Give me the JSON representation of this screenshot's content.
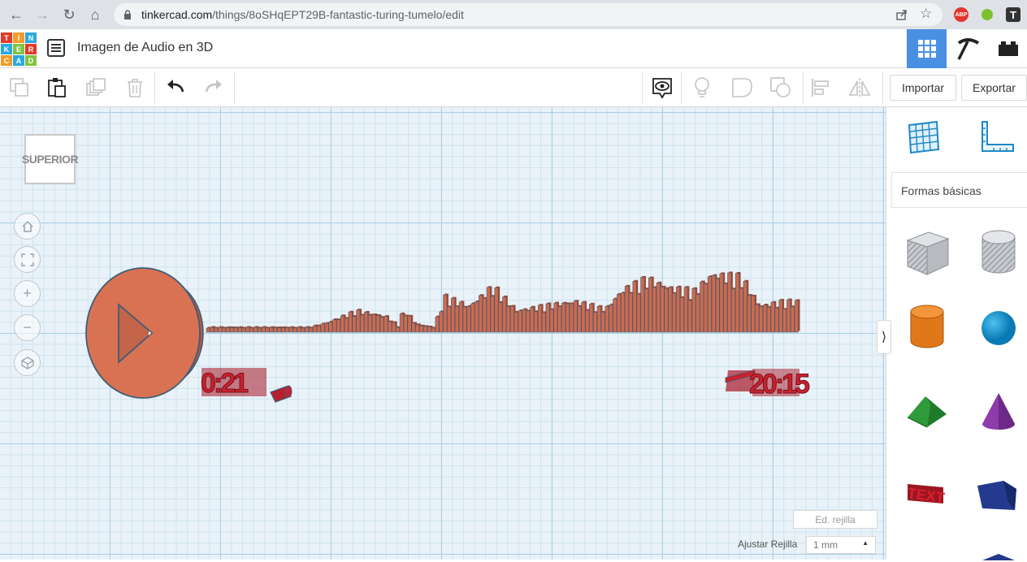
{
  "browser": {
    "url_domain": "tinkercad.com",
    "url_path": "/things/8oSHqEPT29B-fantastic-turing-tumelo/edit",
    "extensions": [
      "ABP",
      "T"
    ]
  },
  "app": {
    "logo_letters": [
      "T",
      "I",
      "N",
      "K",
      "E",
      "R",
      "C",
      "A",
      "D"
    ],
    "design_title": "Imagen de Audio en 3D",
    "views": [
      "grid-view-icon",
      "pickaxe-icon",
      "bricks-icon"
    ]
  },
  "toolbar": {
    "import_label": "Importar",
    "export_label": "Exportar"
  },
  "workplane": {
    "view_cube_label": "SUPERIOR",
    "grid_edit_label": "Ed. rejilla",
    "snap_label": "Ajustar Rejilla",
    "snap_value": "1 mm"
  },
  "scene": {
    "start_time": "0:21",
    "end_time": "20:15"
  },
  "panel": {
    "category_label": "Formas básicas",
    "shapes": [
      "box",
      "cylinder-striped",
      "cylinder",
      "sphere",
      "roof",
      "cone",
      "text",
      "polygon"
    ]
  },
  "colors": {
    "accent_blue": "#4a90e2",
    "shape_orange": "#d1694d",
    "shape_red": "#c8212f",
    "grid_line": "#a9cfe6"
  }
}
